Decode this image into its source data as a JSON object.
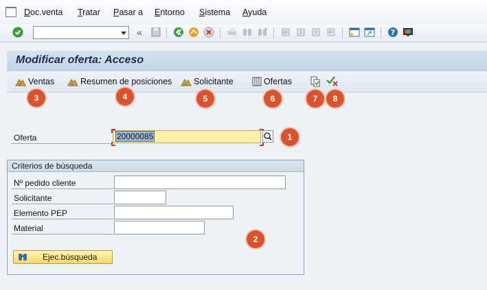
{
  "menu": {
    "items": [
      {
        "pre": "",
        "u": "D",
        "post": "oc.venta"
      },
      {
        "pre": "",
        "u": "T",
        "post": "ratar"
      },
      {
        "pre": "",
        "u": "P",
        "post": "asar a"
      },
      {
        "pre": "",
        "u": "E",
        "post": "ntorno"
      },
      {
        "pre": "",
        "u": "S",
        "post": "istema"
      },
      {
        "pre": "",
        "u": "A",
        "post": "yuda"
      }
    ]
  },
  "toolbar": {
    "command_field_value": "",
    "back_glyph": "«"
  },
  "screen": {
    "title": "Modificar oferta: Acceso"
  },
  "app_toolbar": {
    "ventas": "Ventas",
    "resumen": "Resumen de posiciones",
    "solicitante": "Solicitante",
    "ofertas": "Ofertas"
  },
  "oferta": {
    "label": "Oferta",
    "value": "20000085"
  },
  "search": {
    "title": "Criterios de búsqueda",
    "fields": [
      {
        "label": "Nº pedido cliente",
        "value": ""
      },
      {
        "label": "Solicitante",
        "value": ""
      },
      {
        "label": "Elemento PEP",
        "value": ""
      },
      {
        "label": "Material",
        "value": ""
      }
    ],
    "button": "Ejec.búsqueda"
  },
  "badges": [
    "1",
    "2",
    "3",
    "4",
    "5",
    "6",
    "7",
    "8"
  ],
  "colors": {
    "badge": "#d9532e",
    "title_bar": "#c9d8e9",
    "required_field": "#fdf0a6"
  }
}
